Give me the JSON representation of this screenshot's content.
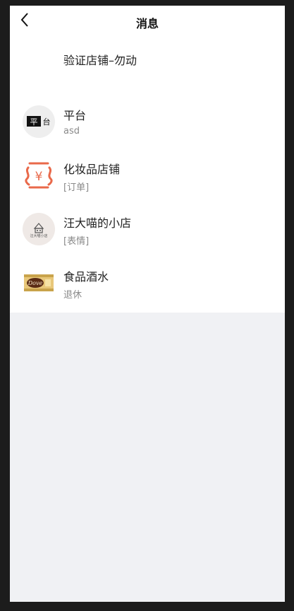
{
  "header": {
    "title": "消息"
  },
  "verify": {
    "label": "验证店铺–勿动"
  },
  "conversations": [
    {
      "name": "平台",
      "preview": "asd",
      "avatar_text": "平台"
    },
    {
      "name": "化妆品店铺",
      "preview": "[订单]",
      "avatar_icon": "yen-icon"
    },
    {
      "name": "汪大喵的小店",
      "preview": "[表情]",
      "avatar_text": "汪大喵小店"
    },
    {
      "name": "食品酒水",
      "preview": "退休",
      "avatar_text": "Dove"
    }
  ],
  "colors": {
    "accent": "#e9694a",
    "background": "#f0f1f4"
  }
}
